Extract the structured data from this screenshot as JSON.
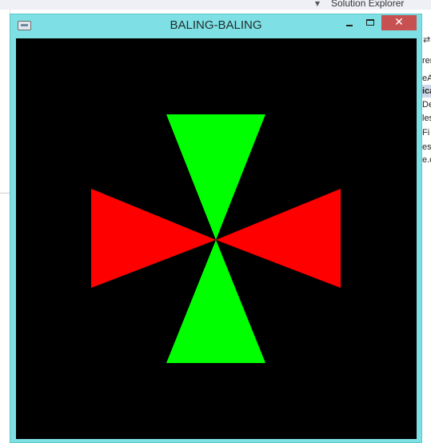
{
  "ide": {
    "panel_title": "Solution Explorer",
    "right_items": [
      "ren",
      "eA",
      "ica",
      "Dep",
      "les",
      "Fi",
      "es",
      "e.c"
    ]
  },
  "window": {
    "title": "BALING-BALING",
    "minimize_glyph": "‒",
    "close_glyph": "✕"
  },
  "colors": {
    "window_frame": "#7ee0e4",
    "canvas_background": "#000000",
    "vertical_blades": "#00ff00",
    "horizontal_blades": "#ff0000",
    "close_button": "#c75050"
  }
}
